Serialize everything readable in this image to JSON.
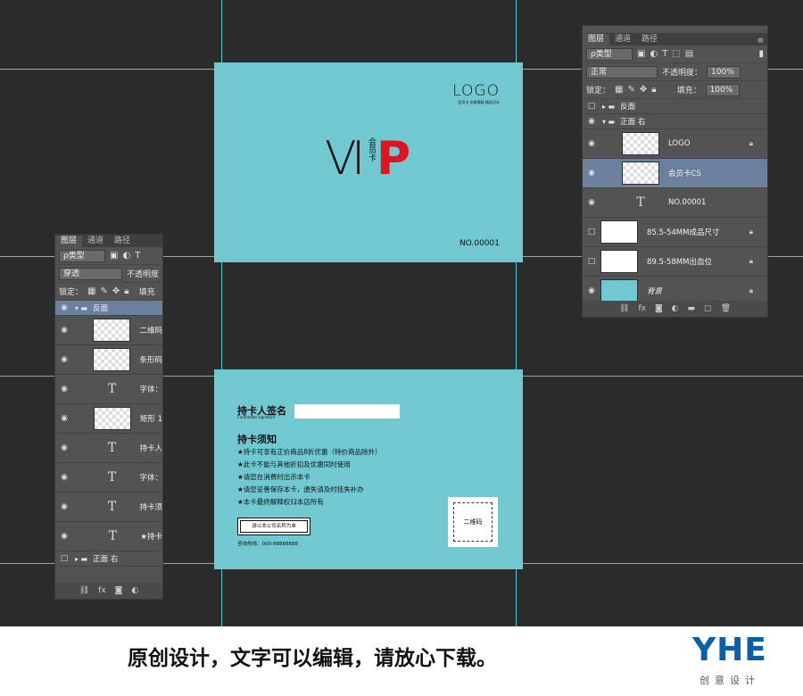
{
  "front": {
    "logo": "LOGO",
    "logo_sub": "会员卡 创意模板 精选设计",
    "vip_v": "V",
    "vip_i": "I",
    "vip_vertical": "会员卡",
    "vip_p": "P",
    "number": "NO.00001"
  },
  "back": {
    "sig_label": "持卡人签名",
    "sig_en": "Cardholder signature",
    "notice_title": "持卡须知",
    "notices": [
      "★持卡可享有正价商品8折优惠（特价商品除外）",
      "★此卡不能与其他折扣及优惠同时使用",
      "★请您在消费时出示本卡",
      "★请您妥善保存本卡，遗失请及时挂失补办",
      "★本卡最终解释权归本店所有"
    ],
    "button": "请以本公司名称为准",
    "phone": "咨询热线：000-88888888",
    "qr": "二维码"
  },
  "panel_left": {
    "tabs": [
      "图层",
      "通道",
      "路径"
    ],
    "filter": "ρ类型",
    "blend": "穿透",
    "opacity_label": "不透明度",
    "lock_label": "锁定：",
    "fill_label": "填充",
    "layers": [
      {
        "name": "反面",
        "kind": "group-open"
      },
      {
        "name": "二维码",
        "kind": "thumb"
      },
      {
        "name": "条形码",
        "kind": "thumb"
      },
      {
        "name": "字体：",
        "kind": "text"
      },
      {
        "name": "矩形 1",
        "kind": "thumb"
      },
      {
        "name": "持卡人",
        "kind": "text"
      },
      {
        "name": "字体：",
        "kind": "text"
      },
      {
        "name": "持卡须",
        "kind": "text"
      },
      {
        "name": "★持卡",
        "kind": "text"
      },
      {
        "name": "正面 右",
        "kind": "group-closed"
      }
    ]
  },
  "panel_right": {
    "tabs": [
      "图层",
      "通道",
      "路径"
    ],
    "filter": "ρ类型",
    "blend": "正常",
    "opacity_label": "不透明度：",
    "opacity_value": "100%",
    "lock_label": "锁定：",
    "fill_label": "填充：",
    "fill_value": "100%",
    "layers": [
      {
        "name": "反面",
        "kind": "group-closed"
      },
      {
        "name": "正面 右",
        "kind": "group-open"
      },
      {
        "name": "LOGO",
        "kind": "thumb"
      },
      {
        "name": "会员卡CS",
        "kind": "thumb-selected"
      },
      {
        "name": "NO.00001",
        "kind": "text"
      },
      {
        "name": "85.5-54MM成品尺寸",
        "kind": "white"
      },
      {
        "name": "89.5-58MM出血位",
        "kind": "white"
      },
      {
        "name": "背景",
        "kind": "cyan"
      }
    ]
  },
  "caption": "原创设计，文字可以编辑，请放心下载。",
  "brand": {
    "name": "YHE",
    "sub": "创意设计",
    "color": "#0b5ea8"
  },
  "colors": {
    "card": "#72c8d1",
    "canvas": "#2b2b2b",
    "panel": "#535353",
    "selected_layer": "#6b7f9e",
    "vip_red": "#e0141e"
  }
}
